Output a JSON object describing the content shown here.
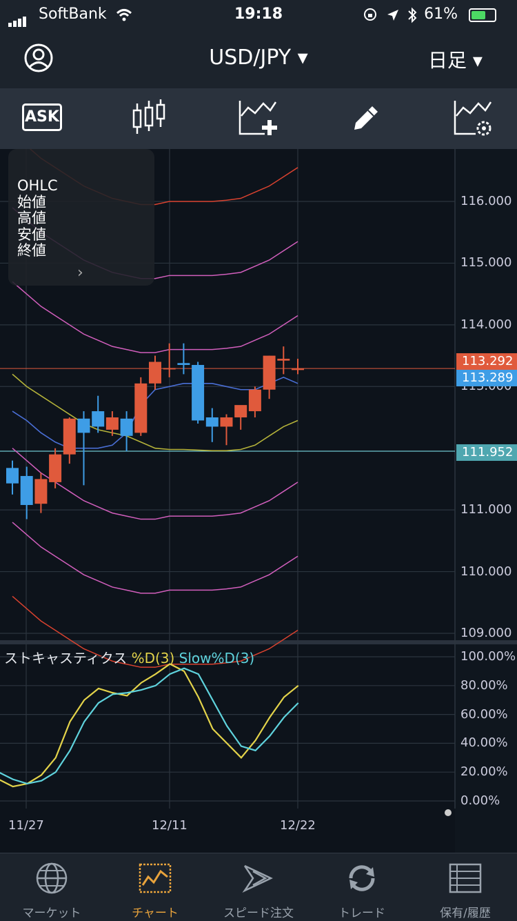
{
  "status": {
    "carrier": "SoftBank",
    "time": "19:18",
    "battery": "61%",
    "battery_level": 0.61
  },
  "header": {
    "pair": "USD/JPY ▾",
    "timeframe": "日足 ▾"
  },
  "toolbar": {
    "ask_label": "ASK"
  },
  "ohlc_panel": {
    "rows": [
      "OHLC",
      "始値",
      "高値",
      "安値",
      "終値"
    ],
    "chevron": "›"
  },
  "price_tags": {
    "ask": "113.292",
    "bid": "113.289",
    "line": "111.952"
  },
  "osc_label": {
    "name": "ストキャスティクス",
    "d": "%D(3)",
    "slow": "Slow%D(3)"
  },
  "tabs": [
    {
      "label": "マーケット",
      "icon": "globe-icon"
    },
    {
      "label": "チャート",
      "icon": "chart-icon"
    },
    {
      "label": "スピード注文",
      "icon": "speed-icon"
    },
    {
      "label": "トレード",
      "icon": "refresh-icon"
    },
    {
      "label": "保有/履歴",
      "icon": "list-icon"
    }
  ],
  "colors": {
    "up": "#e05a3c",
    "down": "#3e9de6",
    "accent": "#e8a33c",
    "pd": "#e3d34a",
    "slow": "#5fd3dd"
  },
  "chart_data": [
    {
      "type": "candlestick",
      "title": "USD/JPY",
      "x_ticks": [
        "11/27",
        "12/11",
        "12/22"
      ],
      "y_ticks": [
        "116.000",
        "115.000",
        "114.000",
        "113.000",
        "111.000",
        "110.000",
        "109.000"
      ],
      "ylim": [
        109.0,
        116.8
      ],
      "candles": [
        {
          "o": 111.68,
          "h": 111.8,
          "l": 111.25,
          "c": 111.43
        },
        {
          "o": 111.55,
          "h": 111.7,
          "l": 110.85,
          "c": 111.08
        },
        {
          "o": 111.1,
          "h": 111.6,
          "l": 110.95,
          "c": 111.5
        },
        {
          "o": 111.45,
          "h": 112.0,
          "l": 111.35,
          "c": 111.9
        },
        {
          "o": 111.9,
          "h": 112.5,
          "l": 111.75,
          "c": 112.48
        },
        {
          "o": 112.48,
          "h": 112.6,
          "l": 111.4,
          "c": 112.25
        },
        {
          "o": 112.6,
          "h": 112.85,
          "l": 112.25,
          "c": 112.35
        },
        {
          "o": 112.3,
          "h": 112.6,
          "l": 112.2,
          "c": 112.5
        },
        {
          "o": 112.48,
          "h": 112.6,
          "l": 111.95,
          "c": 112.2
        },
        {
          "o": 112.25,
          "h": 113.15,
          "l": 112.2,
          "c": 113.05
        },
        {
          "o": 113.05,
          "h": 113.5,
          "l": 112.95,
          "c": 113.4
        },
        {
          "o": 113.3,
          "h": 113.7,
          "l": 113.15,
          "c": 113.3
        },
        {
          "o": 113.38,
          "h": 113.7,
          "l": 113.2,
          "c": 113.35
        },
        {
          "o": 113.35,
          "h": 113.4,
          "l": 112.4,
          "c": 112.45
        },
        {
          "o": 112.5,
          "h": 112.65,
          "l": 112.1,
          "c": 112.35
        },
        {
          "o": 112.35,
          "h": 112.55,
          "l": 112.05,
          "c": 112.5
        },
        {
          "o": 112.5,
          "h": 112.6,
          "l": 112.3,
          "c": 112.7
        },
        {
          "o": 112.6,
          "h": 113.0,
          "l": 112.5,
          "c": 112.95
        },
        {
          "o": 112.95,
          "h": 113.5,
          "l": 112.8,
          "c": 113.5
        },
        {
          "o": 113.42,
          "h": 113.65,
          "l": 113.2,
          "c": 113.45
        },
        {
          "o": 113.29,
          "h": 113.45,
          "l": 113.2,
          "c": 113.29
        }
      ],
      "horizontal_lines": [
        113.292,
        111.952
      ]
    },
    {
      "type": "line",
      "title": "ストキャスティクス",
      "ylim": [
        0,
        100
      ],
      "y_ticks": [
        "100.00%",
        "80.00%",
        "60.00%",
        "40.00%",
        "20.00%",
        "0.00%"
      ],
      "series": [
        {
          "name": "%D(3)",
          "values": [
            15,
            10,
            12,
            18,
            30,
            55,
            70,
            78,
            75,
            73,
            82,
            88,
            95,
            90,
            72,
            50,
            40,
            30,
            42,
            58,
            72,
            80
          ]
        },
        {
          "name": "Slow%D(3)",
          "values": [
            20,
            15,
            12,
            14,
            20,
            35,
            55,
            68,
            74,
            75,
            77,
            80,
            88,
            92,
            88,
            70,
            52,
            38,
            35,
            45,
            58,
            68
          ]
        }
      ]
    }
  ]
}
